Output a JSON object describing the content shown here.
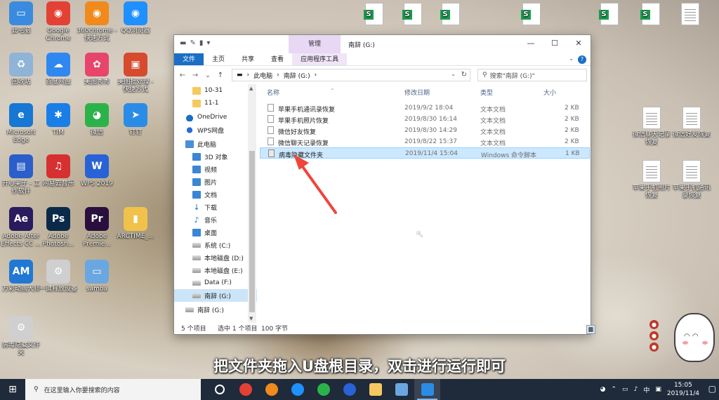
{
  "desktop_left": [
    {
      "label": "此电脑",
      "color": "#3a8be0",
      "glyph": "▭"
    },
    {
      "label": "Google Chrome",
      "color": "#e34133",
      "glyph": "◉"
    },
    {
      "label": "360chrome - 快速方式",
      "color": "#f08a1c",
      "glyph": "◉"
    },
    {
      "label": "QQ浏览器",
      "color": "#1e90ff",
      "glyph": "◉"
    },
    {
      "label": "回收站",
      "color": "#8fb4d8",
      "glyph": "♻"
    },
    {
      "label": "百度网盘",
      "color": "#2f87f0",
      "glyph": "☁"
    },
    {
      "label": "美图秀秀",
      "color": "#e8456b",
      "glyph": "✿"
    },
    {
      "label": "美图批处理 - 快捷方式",
      "color": "#d64b2f",
      "glyph": "▣"
    },
    {
      "label": "Microsoft Edge",
      "color": "#1677d4",
      "glyph": "e"
    },
    {
      "label": "TIM",
      "color": "#1a7ee8",
      "glyph": "✱"
    },
    {
      "label": "微信",
      "color": "#2bb34a",
      "glyph": "◕"
    },
    {
      "label": "钉钉",
      "color": "#2a8ce6",
      "glyph": "➤"
    },
    {
      "label": "开心果子 - 工作软件",
      "color": "#2a5ec9",
      "glyph": "▤"
    },
    {
      "label": "网易云音乐",
      "color": "#d63031",
      "glyph": "♫"
    },
    {
      "label": "WPS 2019",
      "color": "#2862d6",
      "glyph": "W"
    },
    {
      "label": "Adobe After Effects CC ...",
      "color": "#2a1a5e",
      "glyph": "Ae"
    },
    {
      "label": "Adobe Photosh...",
      "color": "#0b2a4a",
      "glyph": "Ps"
    },
    {
      "label": "Adobe Premie...",
      "color": "#2a0f3e",
      "glyph": "Pr"
    },
    {
      "label": "ARCTIME_...",
      "color": "#f0c24a",
      "glyph": "▮"
    },
    {
      "label": "万彩动画大师",
      "color": "#2178d4",
      "glyph": "AM"
    },
    {
      "label": "一键释放设备",
      "color": "#cfcfcf",
      "glyph": "⚙"
    },
    {
      "label": "samba",
      "color": "#6aa7e0",
      "glyph": "▭"
    },
    {
      "label": "病毒隐藏文件夹",
      "color": "#cfcfcf",
      "glyph": "⚙"
    }
  ],
  "desktop_right": [
    {
      "label": "微信聊天记录恢复"
    },
    {
      "label": "微信好友恢复"
    },
    {
      "label": "苹果手机照片恢复"
    },
    {
      "label": "苹果手机通讯录恢复"
    }
  ],
  "window": {
    "manage_tab": "管理",
    "title": "南辞 (G:)",
    "ribbon_tabs": [
      "文件",
      "主页",
      "共享",
      "查看",
      "应用程序工具"
    ],
    "address": {
      "root": "此电脑",
      "sep": "›",
      "current": "南辞 (G:)"
    },
    "search_placeholder": "搜索\"南辞 (G:)\"",
    "nav": [
      {
        "label": "10-31",
        "icon": "folder",
        "indent": 1
      },
      {
        "label": "11-1",
        "icon": "folder",
        "indent": 1
      },
      {
        "label": "OneDrive",
        "icon": "cloud",
        "indent": 0
      },
      {
        "label": "WPS网盘",
        "icon": "wps",
        "indent": 0
      },
      {
        "label": "此电脑",
        "icon": "pc",
        "indent": 0
      },
      {
        "label": "3D 对象",
        "icon": "blue",
        "indent": 1
      },
      {
        "label": "视频",
        "icon": "blue",
        "indent": 1
      },
      {
        "label": "图片",
        "icon": "blue",
        "indent": 1
      },
      {
        "label": "文档",
        "icon": "blue",
        "indent": 1
      },
      {
        "label": "下载",
        "icon": "down",
        "indent": 1
      },
      {
        "label": "音乐",
        "icon": "music",
        "indent": 1
      },
      {
        "label": "桌面",
        "icon": "blue",
        "indent": 1
      },
      {
        "label": "系统 (C:)",
        "icon": "drive",
        "indent": 1
      },
      {
        "label": "本地磁盘 (D:)",
        "icon": "drive",
        "indent": 1
      },
      {
        "label": "本地磁盘 (E:)",
        "icon": "drive",
        "indent": 1
      },
      {
        "label": "Data (F:)",
        "icon": "drive",
        "indent": 1
      },
      {
        "label": "南辞 (G:)",
        "icon": "drive",
        "indent": 1,
        "selected": true
      },
      {
        "label": "南辞 (G:)",
        "icon": "drive",
        "indent": 0
      }
    ],
    "columns": {
      "name": "名称",
      "date": "修改日期",
      "type": "类型",
      "size": "大小"
    },
    "files": [
      {
        "name": "苹果手机通讯录恢复",
        "date": "2019/9/2 18:04",
        "type": "文本文档",
        "size": "2 KB"
      },
      {
        "name": "苹果手机照片恢复",
        "date": "2019/8/30 16:14",
        "type": "文本文档",
        "size": "2 KB"
      },
      {
        "name": "微信好友恢复",
        "date": "2019/8/30 14:29",
        "type": "文本文档",
        "size": "2 KB"
      },
      {
        "name": "微信聊天记录恢复",
        "date": "2019/8/22 15:37",
        "type": "文本文档",
        "size": "2 KB"
      },
      {
        "name": "病毒隐藏文件夹",
        "date": "2019/11/4 15:04",
        "type": "Windows 命令脚本",
        "size": "1 KB",
        "selected": true
      }
    ],
    "status": {
      "count": "5 个项目",
      "selected": "选中 1 个项目",
      "size": "100 字节"
    }
  },
  "subtitle": "把文件夹拖入U盘根目录，双击进行运行即可",
  "taskbar": {
    "search_placeholder": "在这里输入你要搜索的内容",
    "apps": [
      {
        "name": "task-view",
        "color": "#ffffff"
      },
      {
        "name": "chrome",
        "color": "#e34133"
      },
      {
        "name": "360chrome",
        "color": "#f08a1c"
      },
      {
        "name": "qq-browser",
        "color": "#1e90ff"
      },
      {
        "name": "wechat",
        "color": "#2bb34a"
      },
      {
        "name": "wps",
        "color": "#2862d6"
      },
      {
        "name": "file-explorer",
        "color": "#f5c960"
      },
      {
        "name": "app",
        "color": "#6aa7e0"
      },
      {
        "name": "dingtalk",
        "color": "#2a8ce6"
      }
    ],
    "ime": "中",
    "time": "15:05",
    "date": "2019/11/4"
  }
}
